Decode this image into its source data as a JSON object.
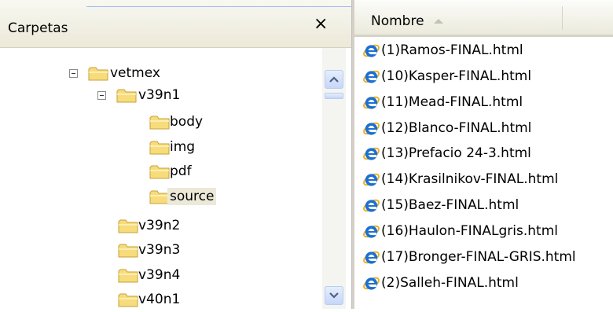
{
  "folders_pane": {
    "title": "Carpetas",
    "close_label": "×",
    "tree": [
      {
        "label": "vetmex",
        "expander": true,
        "selected": false
      },
      {
        "label": "v39n1",
        "expander": true,
        "selected": false
      },
      {
        "label": "body",
        "expander": false,
        "selected": false
      },
      {
        "label": "img",
        "expander": false,
        "selected": false
      },
      {
        "label": "pdf",
        "expander": false,
        "selected": false
      },
      {
        "label": "source",
        "expander": false,
        "selected": true
      },
      {
        "label": "v39n2",
        "expander": false,
        "selected": false
      },
      {
        "label": "v39n3",
        "expander": false,
        "selected": false
      },
      {
        "label": "v39n4",
        "expander": false,
        "selected": false
      },
      {
        "label": "v40n1",
        "expander": false,
        "selected": false
      }
    ]
  },
  "files_pane": {
    "column_header": "Nombre",
    "files": [
      "(1)Ramos-FINAL.html",
      "(10)Kasper-FINAL.html",
      "(11)Mead-FINAL.html",
      "(12)Blanco-FINAL.html",
      "(13)Prefacio 24-3.html",
      "(14)Krasilnikov-FINAL.html",
      "(15)Baez-FINAL.html",
      "(16)Haulon-FINALgris.html",
      "(17)Bronger-FINAL-GRIS.html",
      "(2)Salleh-FINAL.html"
    ]
  },
  "colors": {
    "folder_fill": "#f7dc7c",
    "folder_stroke": "#c7a13a",
    "selection_bg": "#ece9d8",
    "ie_blue": "#1c6fd3",
    "ie_ring": "#e8b020"
  },
  "icons": {
    "folder": "folder-icon",
    "file": "ie-html-file-icon",
    "sort": "sort-ascending-icon",
    "scroll_up": "arrow-up-icon",
    "scroll_down": "arrow-down-icon"
  }
}
